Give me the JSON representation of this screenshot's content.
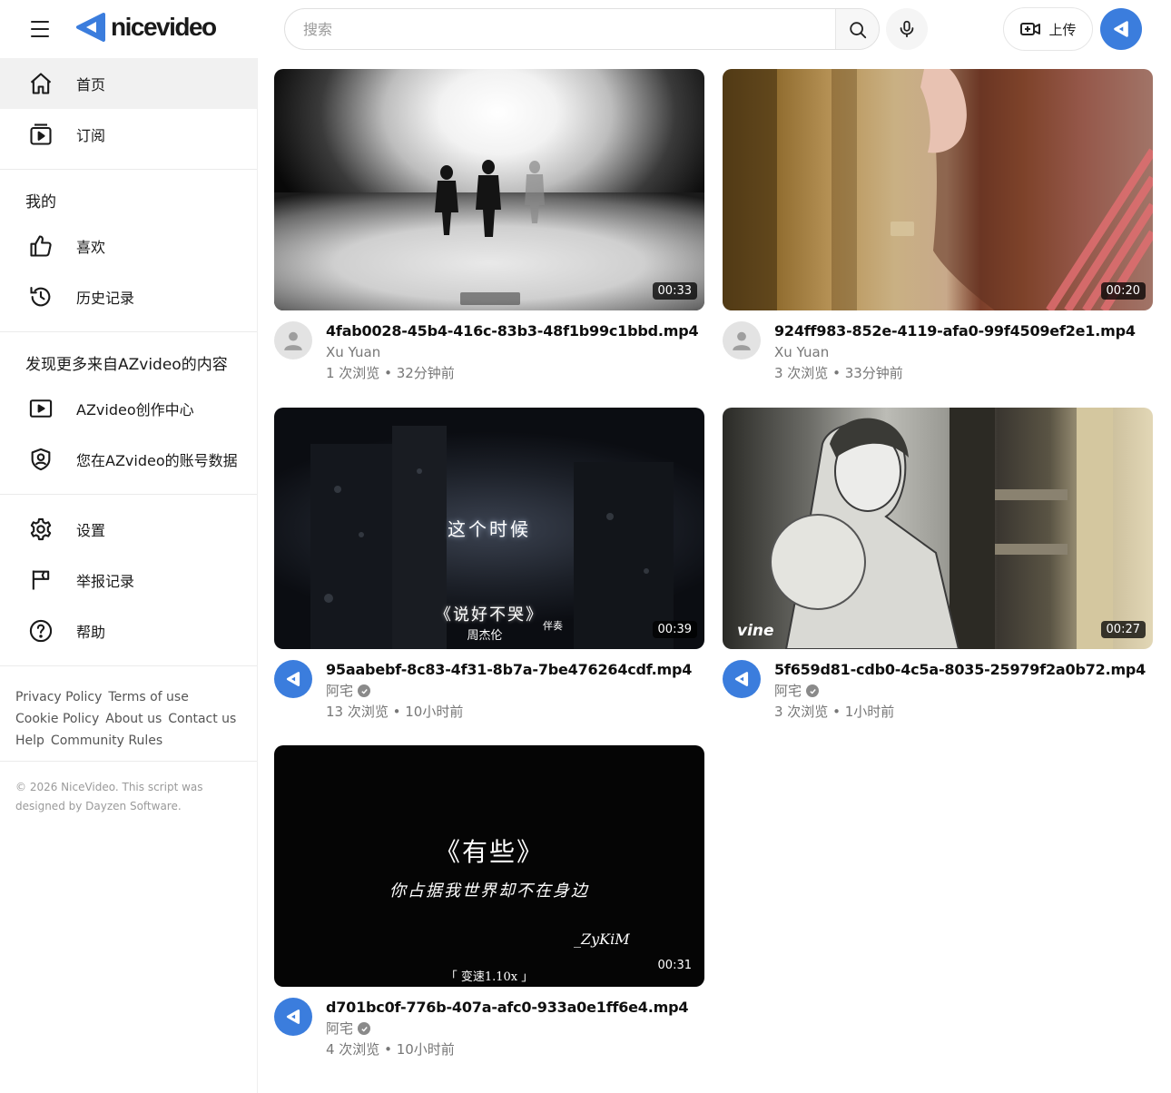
{
  "header": {
    "logo_text": "nicevideo",
    "search_placeholder": "搜索",
    "upload_label": "上传"
  },
  "sidebar": {
    "main": [
      {
        "label": "首页",
        "icon": "home-icon",
        "active": true
      },
      {
        "label": "订阅",
        "icon": "subscriptions-icon",
        "active": false
      }
    ],
    "mine_title": "我的",
    "mine": [
      {
        "label": "喜欢",
        "icon": "thumbs-up-icon"
      },
      {
        "label": "历史记录",
        "icon": "history-icon"
      }
    ],
    "discover_title": "发现更多来自AZvideo的内容",
    "discover": [
      {
        "label": "AZvideo创作中心",
        "icon": "play-box-icon"
      },
      {
        "label": "您在AZvideo的账号数据",
        "icon": "account-shield-icon"
      }
    ],
    "settings": [
      {
        "label": "设置",
        "icon": "gear-icon"
      },
      {
        "label": "举报记录",
        "icon": "flag-icon"
      },
      {
        "label": "帮助",
        "icon": "help-icon"
      }
    ],
    "footer_links": [
      "Privacy Policy",
      "Terms of use",
      "Cookie Policy",
      "About us",
      "Contact us",
      "Help",
      "Community Rules"
    ],
    "copyright": "© 2026 NiceVideo. This script was designed by Dayzen Software."
  },
  "videos": [
    {
      "title": "4fab0028-45b4-416c-83b3-48f1b99c1bbd.mp4",
      "channel": "Xu Yuan",
      "verified": false,
      "stats": "1 次浏览 • 32分钟前",
      "duration": "00:33",
      "avatar": "default"
    },
    {
      "title": "924ff983-852e-4119-afa0-99f4509ef2e1.mp4",
      "channel": "Xu Yuan",
      "verified": false,
      "stats": "3 次浏览 • 33分钟前",
      "duration": "00:20",
      "avatar": "default"
    },
    {
      "title": "95aabebf-8c83-4f31-8b7a-7be476264cdf.mp4",
      "channel": "阿宅",
      "verified": true,
      "stats": "13 次浏览 • 10小时前",
      "duration": "00:39",
      "avatar": "brand",
      "overlay": [
        "这个时候",
        "《说好不哭》",
        "周杰伦",
        "伴奏"
      ]
    },
    {
      "title": "5f659d81-cdb0-4c5a-8035-25979f2a0b72.mp4",
      "channel": "阿宅",
      "verified": true,
      "stats": "3 次浏览 • 1小时前",
      "duration": "00:27",
      "avatar": "brand",
      "overlay": [
        "vine"
      ]
    },
    {
      "title": "d701bc0f-776b-407a-afc0-933a0e1ff6e4.mp4",
      "channel": "阿宅",
      "verified": true,
      "stats": "4 次浏览 • 10小时前",
      "duration": "00:31",
      "avatar": "brand",
      "overlay": [
        "《有些》",
        "你占据我世界却不在身边",
        "_ZyKiM",
        "「 变速1.10x 」"
      ]
    }
  ],
  "colors": {
    "brand": "#3b7ddd",
    "active_bg": "#f1f1f1",
    "meta_text": "#777777"
  }
}
